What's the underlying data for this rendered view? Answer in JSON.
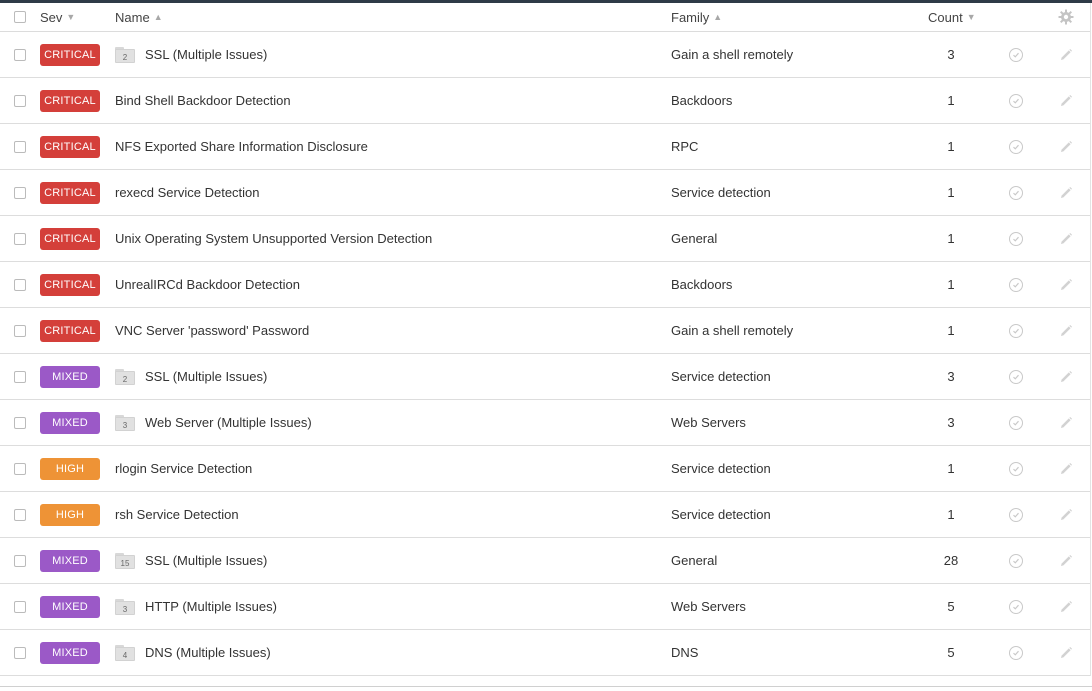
{
  "colors": {
    "critical": "#d43f3a",
    "mixed": "#9b59c7",
    "high": "#ee9336",
    "topbar": "#2f3b47"
  },
  "header": {
    "sev": "Sev",
    "name": "Name",
    "family": "Family",
    "count": "Count",
    "sev_arrow": "▼",
    "name_arrow": "▲",
    "family_arrow": "▲",
    "count_arrow": "▼",
    "settings_icon": "gear-icon"
  },
  "rows": [
    {
      "severity": "CRITICAL",
      "level": "critical",
      "group_count": "2",
      "name": "SSL (Multiple Issues)",
      "family": "Gain a shell remotely",
      "count": "3"
    },
    {
      "severity": "CRITICAL",
      "level": "critical",
      "group_count": null,
      "name": "Bind Shell Backdoor Detection",
      "family": "Backdoors",
      "count": "1"
    },
    {
      "severity": "CRITICAL",
      "level": "critical",
      "group_count": null,
      "name": "NFS Exported Share Information Disclosure",
      "family": "RPC",
      "count": "1"
    },
    {
      "severity": "CRITICAL",
      "level": "critical",
      "group_count": null,
      "name": "rexecd Service Detection",
      "family": "Service detection",
      "count": "1"
    },
    {
      "severity": "CRITICAL",
      "level": "critical",
      "group_count": null,
      "name": "Unix Operating System Unsupported Version Detection",
      "family": "General",
      "count": "1"
    },
    {
      "severity": "CRITICAL",
      "level": "critical",
      "group_count": null,
      "name": "UnrealIRCd Backdoor Detection",
      "family": "Backdoors",
      "count": "1"
    },
    {
      "severity": "CRITICAL",
      "level": "critical",
      "group_count": null,
      "name": "VNC Server 'password' Password",
      "family": "Gain a shell remotely",
      "count": "1"
    },
    {
      "severity": "MIXED",
      "level": "mixed",
      "group_count": "2",
      "name": "SSL (Multiple Issues)",
      "family": "Service detection",
      "count": "3"
    },
    {
      "severity": "MIXED",
      "level": "mixed",
      "group_count": "3",
      "name": "Web Server (Multiple Issues)",
      "family": "Web Servers",
      "count": "3"
    },
    {
      "severity": "HIGH",
      "level": "high",
      "group_count": null,
      "name": "rlogin Service Detection",
      "family": "Service detection",
      "count": "1"
    },
    {
      "severity": "HIGH",
      "level": "high",
      "group_count": null,
      "name": "rsh Service Detection",
      "family": "Service detection",
      "count": "1"
    },
    {
      "severity": "MIXED",
      "level": "mixed",
      "group_count": "15",
      "name": "SSL (Multiple Issues)",
      "family": "General",
      "count": "28"
    },
    {
      "severity": "MIXED",
      "level": "mixed",
      "group_count": "3",
      "name": "HTTP (Multiple Issues)",
      "family": "Web Servers",
      "count": "5"
    },
    {
      "severity": "MIXED",
      "level": "mixed",
      "group_count": "4",
      "name": "DNS (Multiple Issues)",
      "family": "DNS",
      "count": "5"
    }
  ]
}
